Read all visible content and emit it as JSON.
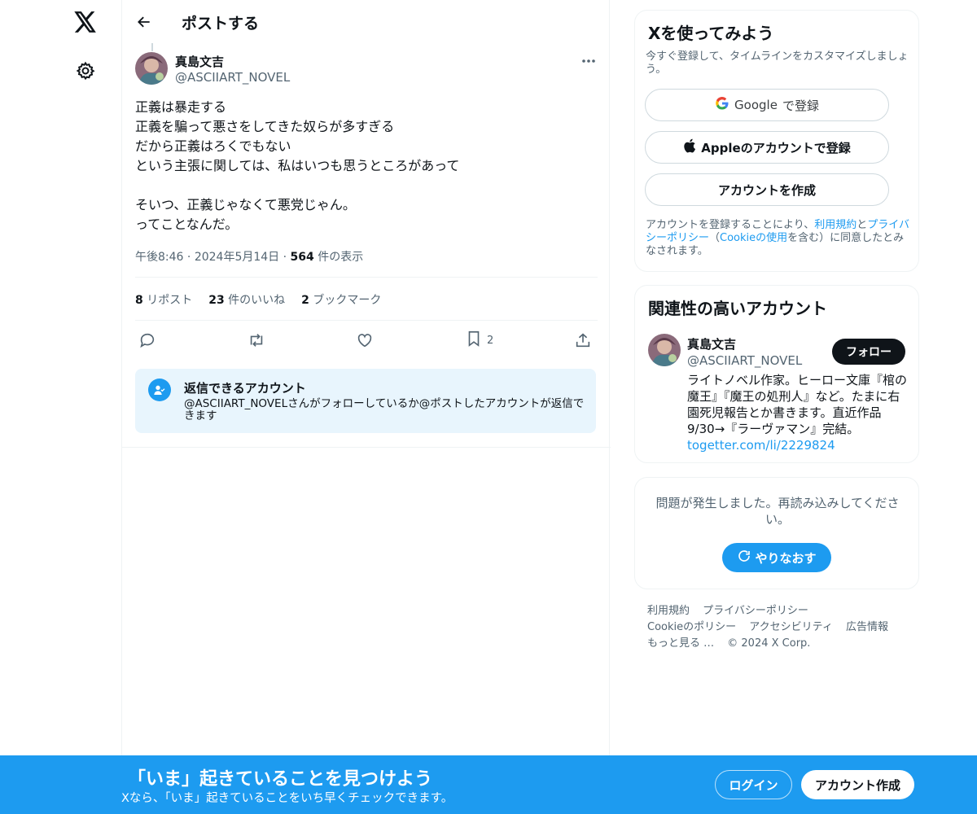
{
  "header": {
    "title": "ポストする"
  },
  "post": {
    "author_name": "真島文吉",
    "author_handle": "@ASCIIART_NOVEL",
    "lines": [
      "正義は暴走する",
      "正義を騙って悪さをしてきた奴らが多すぎる",
      "だから正義はろくでもない",
      "という主張に関しては、私はいつも思うところがあって",
      "",
      "そいつ、正義じゃなくて悪党じゃん。",
      "ってことなんだ。"
    ],
    "time": "午後8:46",
    "date": "2024年5月14日",
    "views_count": "564",
    "views_label": "件の表示",
    "reposts_count": "8",
    "reposts_label": "リポスト",
    "likes_count": "23",
    "likes_label": "件のいいね",
    "bookmarks_count": "2",
    "bookmarks_label": "ブックマーク",
    "bookmark_action_count": "2"
  },
  "reply_restriction": {
    "title": "返信できるアカウント",
    "description": "@ASCIIART_NOVELさんがフォローしているか@ポストしたアカウントが返信できます"
  },
  "signup": {
    "title": "Xを使ってみよう",
    "subtitle": "今すぐ登録して、タイムラインをカスタマイズしましょう。",
    "google_brand": "Google",
    "google_suffix": "で登録",
    "apple_label": "Appleのアカウントで登録",
    "create_label": "アカウントを作成",
    "terms_prefix": "アカウントを登録することにより、",
    "terms_link": "利用規約",
    "terms_and": "と",
    "privacy_link": "プライバシーポリシー",
    "terms_paren_open": "（",
    "cookie_link": "Cookieの使用",
    "terms_suffix": "を含む）に同意したとみなされます。"
  },
  "related": {
    "title": "関連性の高いアカウント",
    "name": "真島文吉",
    "handle": "@ASCIIART_NOVEL",
    "follow_label": "フォロー",
    "bio": "ライトノベル作家。ヒーロー文庫『棺の魔王』『魔王の処刑人』など。たまに右園死児報告とか書きます。直近作品9/30→『ラーヴァマン』完結。",
    "link": "togetter.com/li/2229824"
  },
  "error_card": {
    "message": "問題が発生しました。再読み込みしてください。",
    "retry_label": "やりなおす"
  },
  "footer": {
    "terms": "利用規約",
    "privacy": "プライバシーポリシー",
    "cookie": "Cookieのポリシー",
    "accessibility": "アクセシビリティ",
    "ads": "広告情報",
    "more": "もっと見る …",
    "copyright": "© 2024 X Corp."
  },
  "banner": {
    "title": "「いま」起きていることを見つけよう",
    "subtitle": "Xなら、「いま」起きていることをいち早くチェックできます。",
    "login_label": "ログイン",
    "create_label": "アカウント作成"
  },
  "colors": {
    "accent": "#1d9bf0",
    "text": "#0f1419",
    "muted": "#536471",
    "border": "#eff3f4"
  },
  "icons": [
    "x-logo-icon",
    "gear-icon",
    "back-arrow-icon",
    "more-icon",
    "reply-icon",
    "repost-icon",
    "like-icon",
    "bookmark-icon",
    "share-icon",
    "person-check-icon",
    "google-icon",
    "apple-icon",
    "refresh-icon"
  ]
}
